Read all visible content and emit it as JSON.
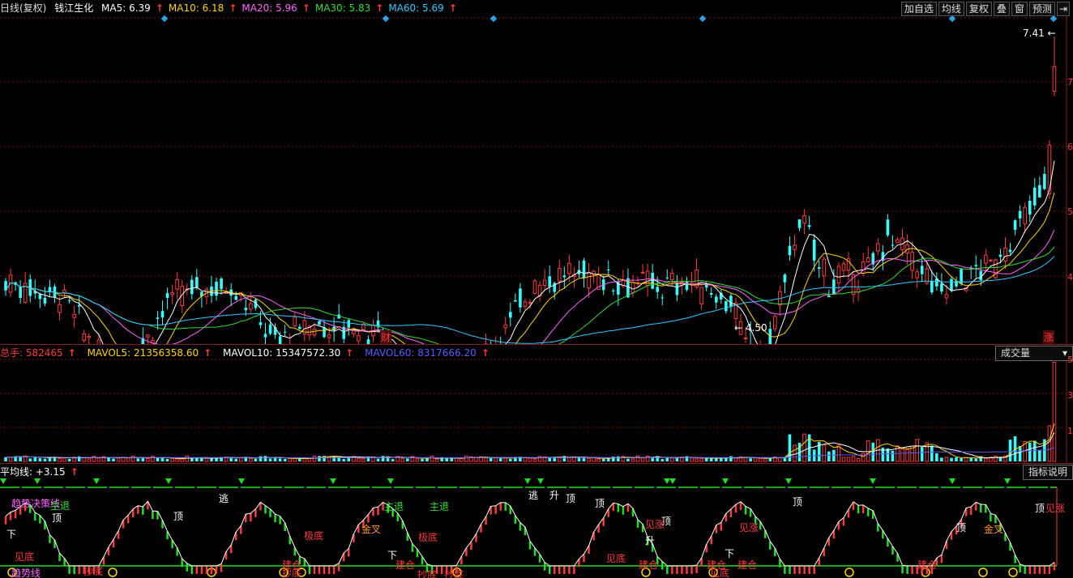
{
  "header": {
    "mode": "日线(复权)",
    "stock": "钱江生化",
    "ma": [
      {
        "label": "MA5: 6.39",
        "color": "#ffffff"
      },
      {
        "label": "MA10: 6.18",
        "color": "#ffd400"
      },
      {
        "label": "MA20: 5.96",
        "color": "#ff66ff"
      },
      {
        "label": "MA30: 5.83",
        "color": "#33dd33"
      },
      {
        "label": "MA60: 5.69",
        "color": "#33ccff"
      }
    ],
    "up_arrow": "↑"
  },
  "toolbar": {
    "add": "加自选",
    "ma": "均线",
    "adj": "复权",
    "stack": "叠",
    "win": "窗",
    "forecast": "预测"
  },
  "price": {
    "high_label": "7.41",
    "low_label": "4.50",
    "cai_mark": "财",
    "zhang_mark": "涨",
    "axis": [
      "7",
      "6",
      "5",
      "4"
    ]
  },
  "volume": {
    "total": "总手: 582465",
    "mavol5": "MAVOL5: 21356358.60",
    "mavol10": "MAVOL10: 15347572.30",
    "mavol60": "MAVOL60: 8317666.20",
    "selector": "成交量",
    "chevron": "▾",
    "axis": [
      "5",
      "3",
      "1"
    ]
  },
  "indicator": {
    "title": "平均线: +3.15",
    "help_button": "指标说明",
    "trend_label": "趋势决策线",
    "signals": [
      {
        "t": "下",
        "c": "#ffffff"
      },
      {
        "t": "主退",
        "c": "#33dd33"
      },
      {
        "t": "顶",
        "c": "#ffffff"
      },
      {
        "t": "见底",
        "c": "#ff3b3b"
      },
      {
        "t": "抄底",
        "c": "#ff3b3b"
      },
      {
        "t": "趋势线",
        "c": "#ff66ff"
      },
      {
        "t": "顶",
        "c": "#ffffff"
      },
      {
        "t": "逃",
        "c": "#ffffff"
      },
      {
        "t": "建仓",
        "c": "#ff3b3b"
      },
      {
        "t": "抄底",
        "c": "#ff3b3b"
      },
      {
        "t": "极底",
        "c": "#ff3b3b"
      },
      {
        "t": "金叉",
        "c": "#ff9922"
      },
      {
        "t": "主退",
        "c": "#33dd33"
      },
      {
        "t": "主退",
        "c": "#33dd33"
      },
      {
        "t": "下",
        "c": "#ffffff"
      },
      {
        "t": "极底",
        "c": "#ff3b3b"
      },
      {
        "t": "建仓",
        "c": "#ff3b3b"
      },
      {
        "t": "抄底",
        "c": "#ff3b3b"
      },
      {
        "t": "抄底",
        "c": "#ff3b3b"
      },
      {
        "t": "逃",
        "c": "#ffffff"
      },
      {
        "t": "升",
        "c": "#ffffff"
      },
      {
        "t": "顶",
        "c": "#ffffff"
      },
      {
        "t": "顶",
        "c": "#ffffff"
      },
      {
        "t": "见底",
        "c": "#ff3b3b"
      },
      {
        "t": "建仓",
        "c": "#ff3b3b"
      },
      {
        "t": "顶",
        "c": "#ffffff"
      },
      {
        "t": "升",
        "c": "#ffffff"
      },
      {
        "t": "见涨",
        "c": "#ff3b3b"
      },
      {
        "t": "建仓",
        "c": "#ff3b3b"
      },
      {
        "t": "见底",
        "c": "#ff3b3b"
      },
      {
        "t": "下",
        "c": "#ffffff"
      },
      {
        "t": "见涨",
        "c": "#ff3b3b"
      },
      {
        "t": "建仓",
        "c": "#ff3b3b"
      },
      {
        "t": "顶",
        "c": "#ffffff"
      },
      {
        "t": "顶",
        "c": "#ffffff"
      },
      {
        "t": "金叉",
        "c": "#ff9922"
      },
      {
        "t": "建仓",
        "c": "#ff3b3b"
      },
      {
        "t": "顶",
        "c": "#ffffff"
      },
      {
        "t": "见涨",
        "c": "#ff3b3b"
      }
    ]
  },
  "colors": {
    "up": "#ff3b3b",
    "down": "#33ffff",
    "grid": "#7a1515",
    "green": "#22dd22",
    "yellow": "#ffd400",
    "diamond": "#2aa6e8"
  }
}
